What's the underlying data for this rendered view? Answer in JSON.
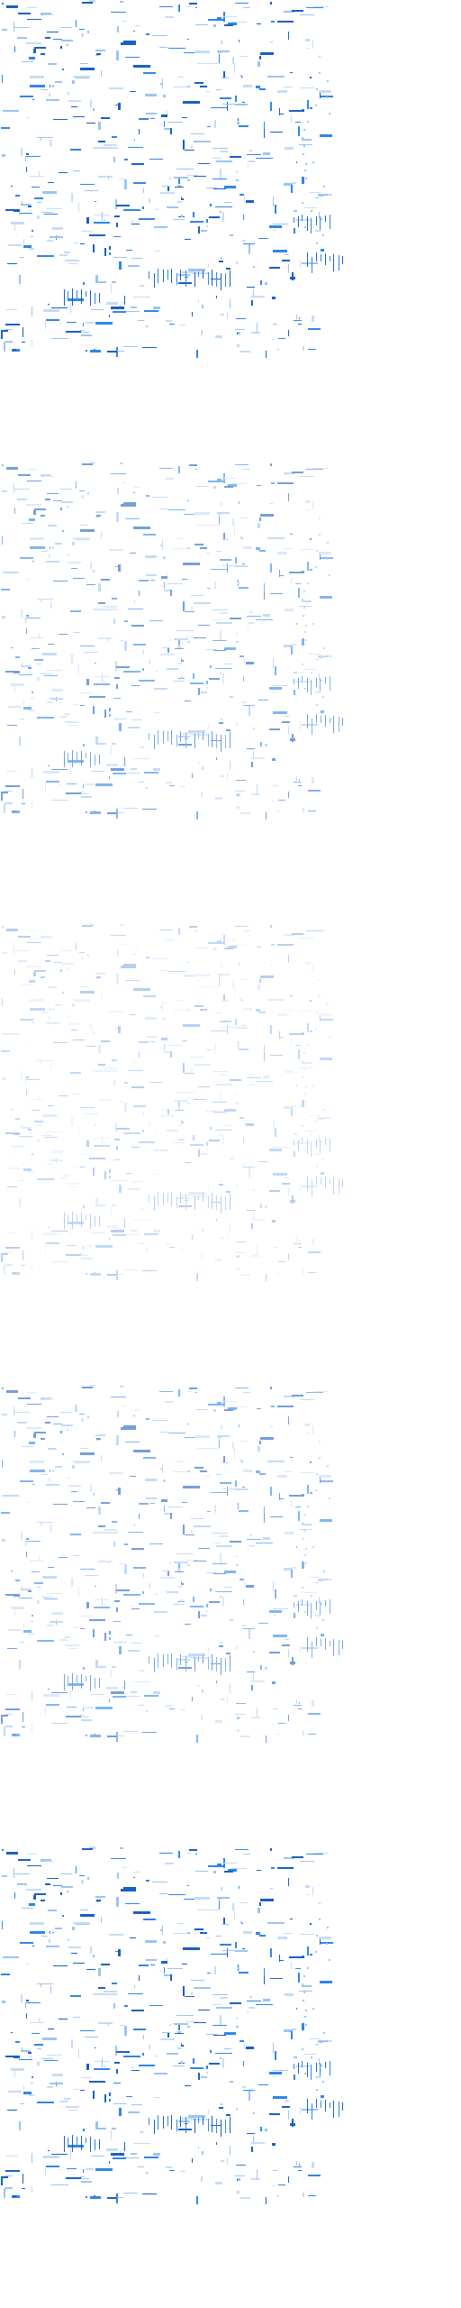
{
  "colors": {
    "background": "#ffffff",
    "mark_dark": "#1a5fc4",
    "mark_mid": "#2f86e8",
    "mark_light": "#9cc4f2",
    "mark_faint": "#c6dcf6"
  },
  "panels": [
    {
      "intensity": "full"
    },
    {
      "intensity": "medium"
    },
    {
      "intensity": "faint"
    },
    {
      "intensity": "medium"
    },
    {
      "intensity": "full"
    }
  ]
}
